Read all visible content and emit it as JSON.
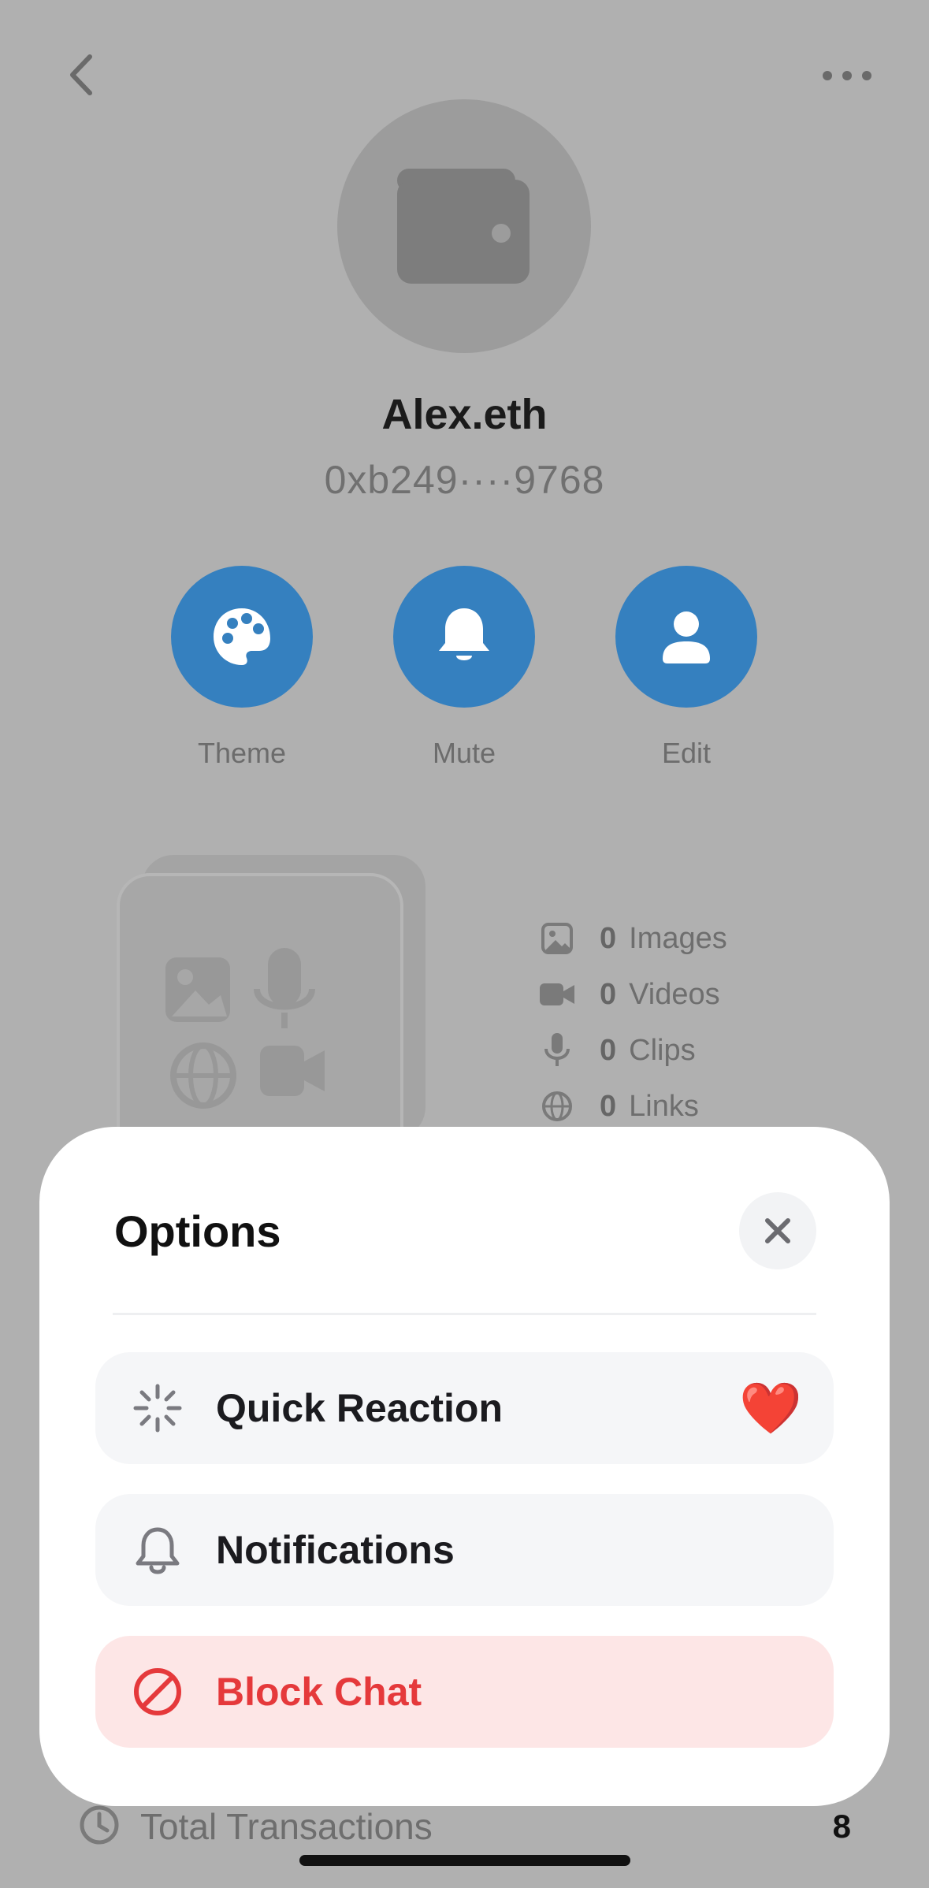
{
  "profile": {
    "name": "Alex.eth",
    "address": "0xb249····9768"
  },
  "actions": [
    {
      "label": "Theme",
      "icon": "palette-icon"
    },
    {
      "label": "Mute",
      "icon": "bell-icon"
    },
    {
      "label": "Edit",
      "icon": "person-icon"
    }
  ],
  "media_stats": [
    {
      "count": "0",
      "label": "Images",
      "icon": "image-icon"
    },
    {
      "count": "0",
      "label": "Videos",
      "icon": "video-icon"
    },
    {
      "count": "0",
      "label": "Clips",
      "icon": "microphone-icon"
    },
    {
      "count": "0",
      "label": "Links",
      "icon": "globe-icon"
    }
  ],
  "transactions": {
    "label": "Total Transactions",
    "value": "8",
    "icon": "clock-icon"
  },
  "sheet": {
    "title": "Options",
    "close_icon": "close-icon",
    "options": [
      {
        "label": "Quick Reaction",
        "icon": "sparkle-loader-icon",
        "trailing": "❤️"
      },
      {
        "label": "Notifications",
        "icon": "bell-outline-icon"
      },
      {
        "label": "Block Chat",
        "icon": "block-icon",
        "style": "danger"
      }
    ]
  },
  "colors": {
    "accent": "#3580bf",
    "danger": "#e5393b",
    "danger_bg": "#fde6e6",
    "overlay": "#b0b0b0"
  }
}
